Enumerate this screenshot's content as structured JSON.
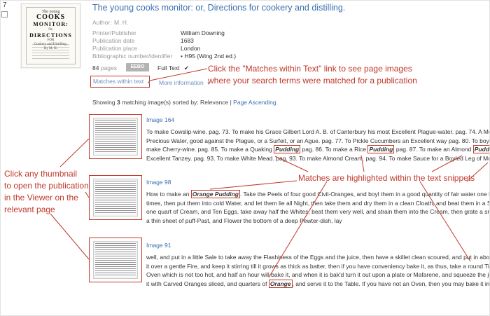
{
  "result": {
    "number": "7",
    "title": "The young cooks monitor: or, Directions for cookery and distilling.",
    "cover": {
      "the": "The young",
      "title_line1": "COOKS",
      "title_line2": "MONITOR:",
      "or": "Or,",
      "directions": "DIRECTIONS",
      "for": "FOR",
      "sub1": "Cookery and Distilling.",
      "by": "By M. H."
    },
    "author_label": "Author:",
    "author_value": "M. H.",
    "fields": [
      {
        "label": "Printer/Publisher",
        "value": "William Downing"
      },
      {
        "label": "Publication date",
        "value": "1683"
      },
      {
        "label": "Publication place",
        "value": "London"
      },
      {
        "label": "Bibliographic number/identifier",
        "value": "•  H95 (Wing 2nd ed.)"
      }
    ],
    "pages_count": "84",
    "pages_unit": "pages",
    "eebo_label": "EEBO",
    "fulltext_label": "Full Text",
    "fulltext_check": "✔",
    "matches_link": "Matches within text",
    "matches_caret": "▲",
    "more_info": "More information",
    "more_info_caret": "▼"
  },
  "callouts": {
    "matches_line1": "Click the \"Matches within Text\" link to see page images",
    "matches_line2": "where your search terms were matched for a publication",
    "thumb_line1": "Click any thumbnail",
    "thumb_line2": "to open the publication",
    "thumb_line3": "in the Viewer on the",
    "thumb_line4": "relevant page",
    "highlight": "Matches are highlighted within the text snippets"
  },
  "showing": {
    "prefix": "Showing",
    "count": "3",
    "mid": "matching image(s) sorted by: Relevance |",
    "sort_link": "Page Ascending"
  },
  "images": [
    {
      "label": "Image 164",
      "lines": [
        [
          "To make Cowslip-wine. pag. 73. To make his Grace Gilbert Lord A. B. of Canterbury his most Excellent Plague-water. pag. 74. A Medicine agai"
        ],
        [
          "Precious Water, good against the Plague, or a Surfeit, or an Ague. pag. 77. To Pickle Cucumbers an Excellent way pag. 80. To boyl Ducks the"
        ],
        [
          "make Cherry-wine. pag. 85. To make a Quaking ",
          {
            "hl": "Pudding"
          },
          " pag. 86. To make a Rice ",
          {
            "hl": "Pudding"
          },
          " pag. 87. To make an Almond ",
          {
            "hl": "Pudding"
          },
          " pag. 88."
        ],
        [
          "Excellent Tanzey. pag. 93. To make White Mead. pag. 93. To make Almond Cream. pag. 94. To make Sauce for a Boyled Leg of Mutton in the"
        ]
      ]
    },
    {
      "label": "Image 98",
      "lines": [
        [
          "How to make an ",
          {
            "hl": "Orange Pudding"
          },
          ". Take the Peels of four good Civil-Oranges, and boyl them in a good quantity of fair water one hour, then po"
        ],
        [
          "times, then put them into cold Water, and let them lie all Night, then take them and dry them in a clean Cloath, and beat them in a Stone or Wo"
        ],
        [
          "one quart of Cream, and Ten Eggs, take away half the Whites, beat them very well, and strain them into the Cream, then grate a small Nutmeg"
        ],
        [
          "a thin sheet of puff-Past, and Flower the bottom of a deep Pewter-dish, lay"
        ]
      ]
    },
    {
      "label": "Image 91",
      "lines": [
        [
          "well, and put in a little Sale to take away the Flashiness of the Eggs and the juice, then have a skillet clean scoured, and put in about two ounc"
        ],
        [
          "it over a gentle Fire, and keep it stirring till it grows as thick as batter, then if you have conveniency bake it, as thus, take a round Tin ",
          {
            "hl": "Pudding"
          }
        ],
        [
          "Oven which is not too hot, and half an hour will bake it, and when it is bak'd turn it out upon a plate or Mafarene, and squeeze the juice of two"
        ],
        [
          "it with Carved Oranges sliced, and quarters of ",
          {
            "hl": "Orange"
          },
          ", and serve it to the Table. If you have not an Oven, then you may bake it in a Frying-pa"
        ]
      ]
    }
  ],
  "colors": {
    "accent_red": "#c0392b",
    "link_blue": "#3a6fb0"
  }
}
